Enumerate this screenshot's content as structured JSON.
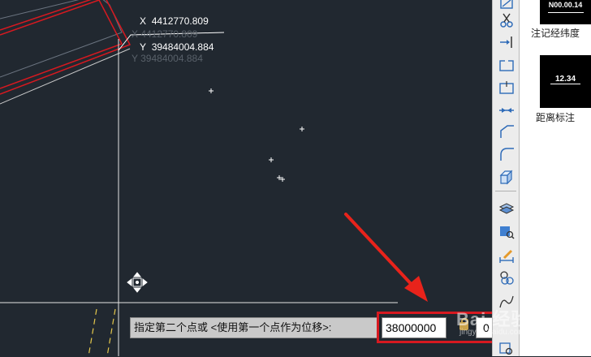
{
  "coordinates": {
    "x_label": "X",
    "x_value": "4412770.809",
    "y_label": "Y",
    "y_value": "39484004.884",
    "ghost_x": "X  4412770.809",
    "ghost_y": "Y  39484004.884"
  },
  "command": {
    "prompt": "指定第二个点或 <使用第一个点作为位移>:",
    "input_value": "38000000",
    "second_input_value": "0"
  },
  "panel": {
    "items": [
      {
        "thumb_text": "N00.00.14",
        "label": "注记经纬度"
      },
      {
        "thumb_text": "12.34",
        "label": "距离标注"
      }
    ]
  },
  "toolbar": {
    "tools": [
      "scale-icon",
      "scissors-icon",
      "extend-icon",
      "break-icon",
      "break-at-point-icon",
      "join-icon",
      "chamfer-icon",
      "fillet-icon",
      "box-3d-icon",
      "layers-icon",
      "zoom-3d-icon",
      "pencil-measure-icon",
      "rings-icon",
      "curve-icon",
      "zoom-window-icon"
    ]
  },
  "watermark": {
    "text": "Bai 经验",
    "url": "jingyan.baidu.com"
  },
  "colors": {
    "canvas_bg": "#212830",
    "boundary_red": "#d71920",
    "highlight_frame": "#d71920",
    "arrow": "#e8231b",
    "dashed_yellow": "#e5c84c"
  }
}
